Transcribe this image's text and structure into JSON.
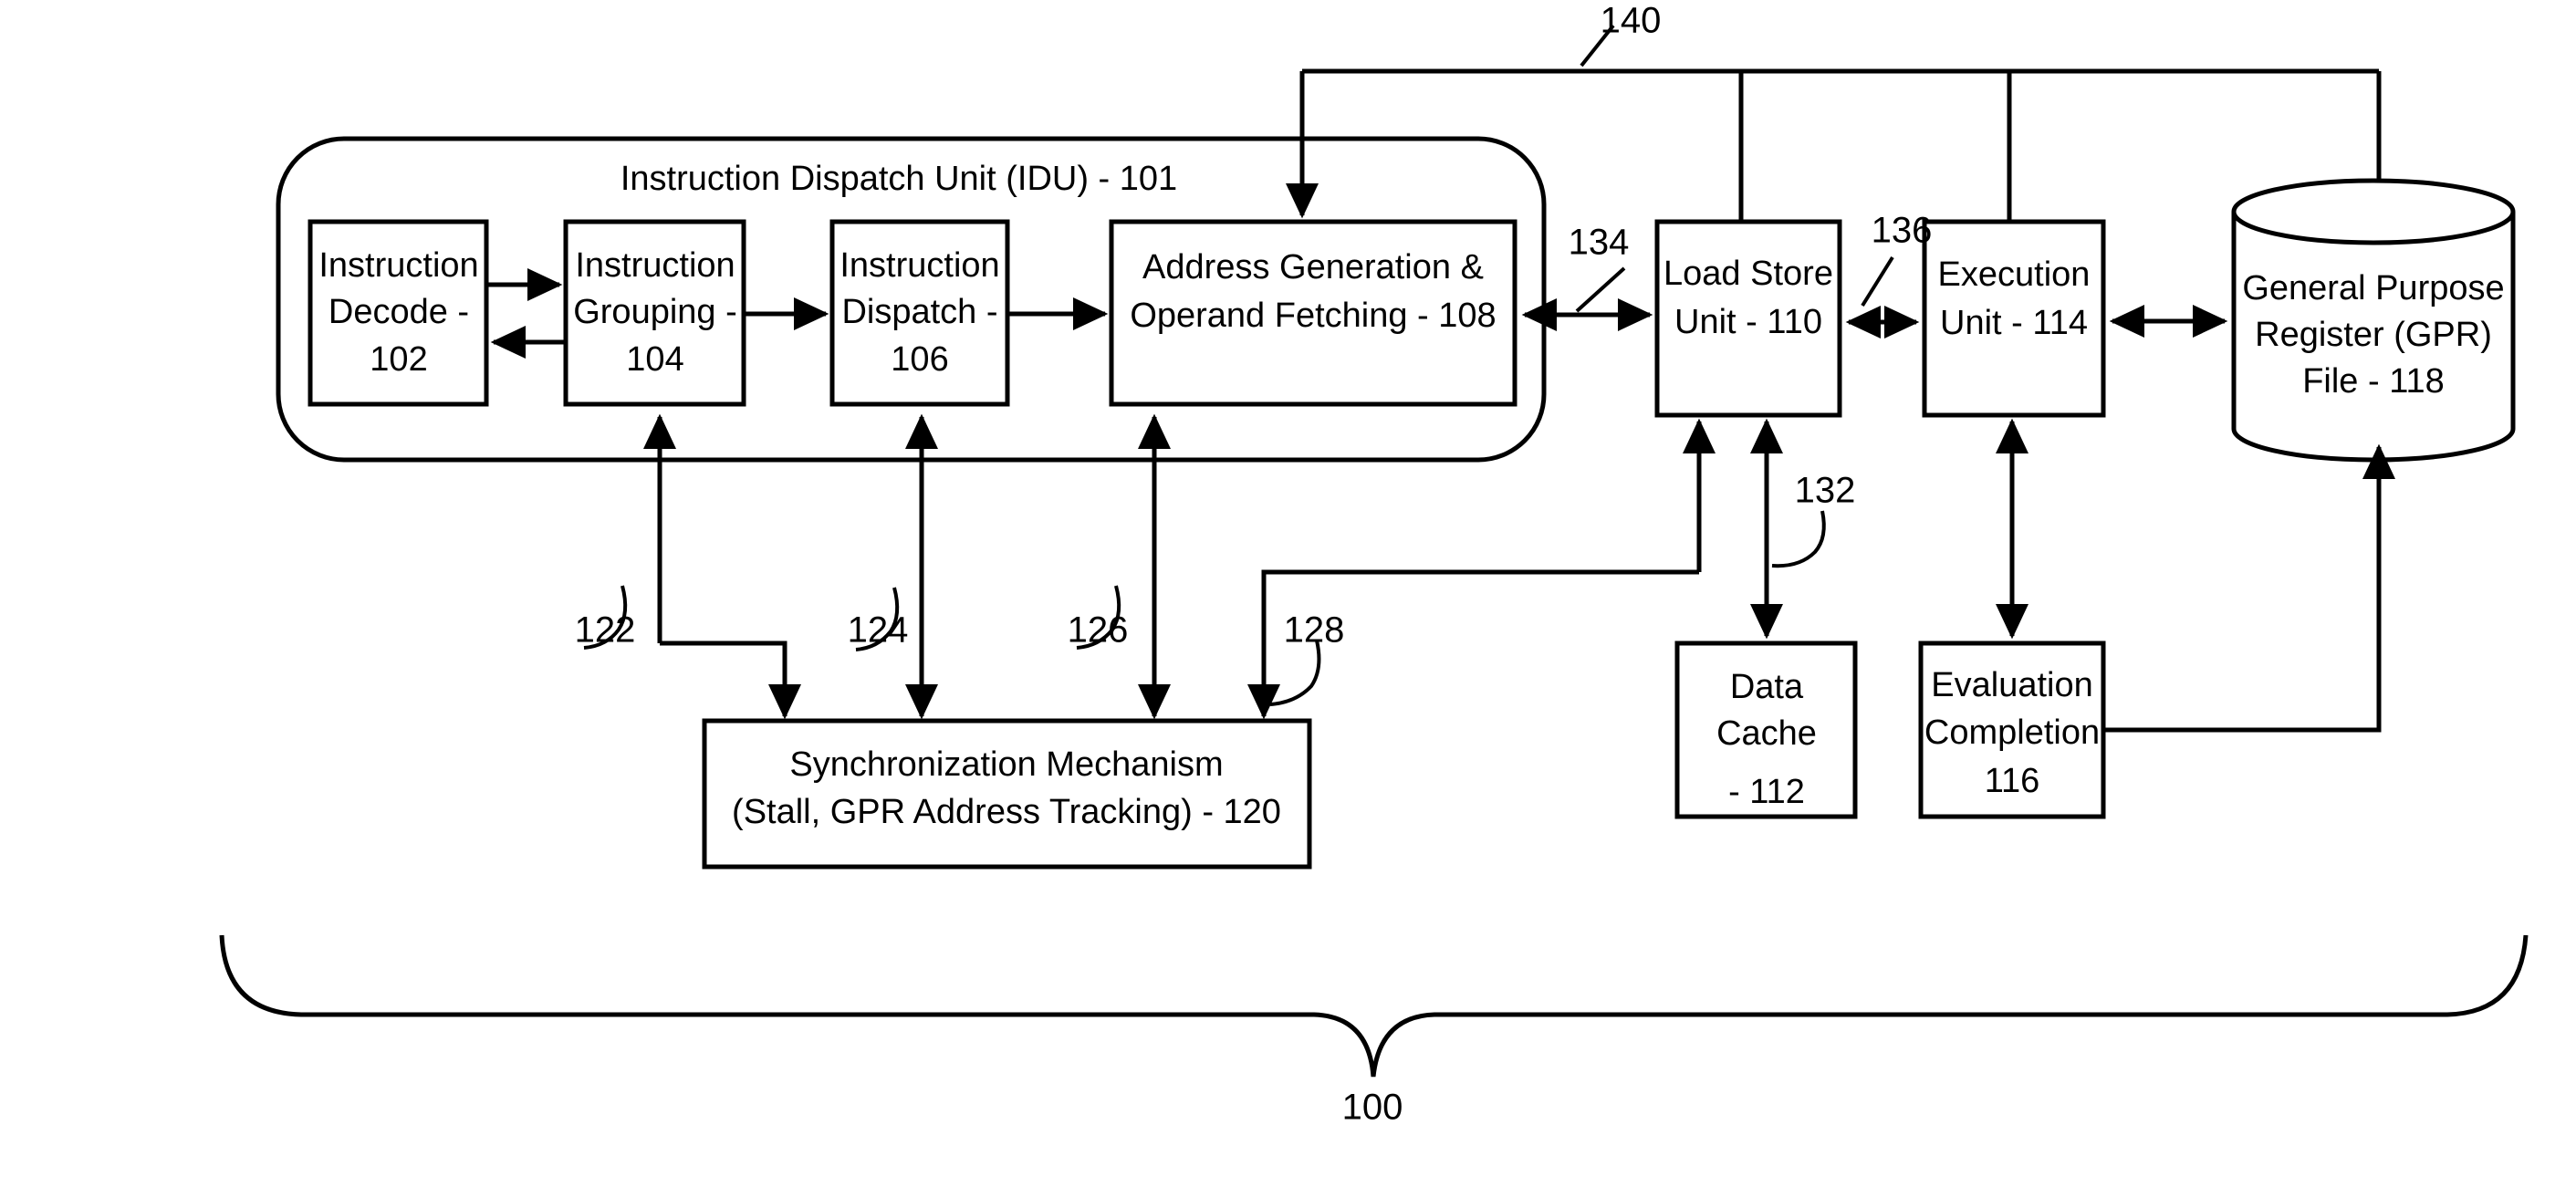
{
  "figure": {
    "overall_reference": "100",
    "bus_reference": "140",
    "idu_title": "Instruction Dispatch Unit (IDU) - 101"
  },
  "blocks": {
    "instruction_decode": {
      "line1": "Instruction",
      "line2": "Decode -",
      "line3": "102"
    },
    "instruction_grouping": {
      "line1": "Instruction",
      "line2": "Grouping -",
      "line3": "104"
    },
    "instruction_dispatch": {
      "line1": "Instruction",
      "line2": "Dispatch -",
      "line3": "106"
    },
    "address_generation": {
      "line1": "Address Generation &",
      "line2": "Operand Fetching - 108"
    },
    "load_store_unit": {
      "line1": "Load Store",
      "line2": "Unit - 110"
    },
    "execution_unit": {
      "line1": "Execution",
      "line2": "Unit - 114"
    },
    "gpr_file": {
      "line1": "General Purpose",
      "line2": "Register (GPR)",
      "line3": "File - 118"
    },
    "data_cache": {
      "line1": "Data",
      "line2": "Cache",
      "line3": "- 112"
    },
    "evaluation_completion": {
      "line1": "Evaluation",
      "line2": "Completion",
      "line3": "116"
    },
    "synchronization_mechanism": {
      "line1": "Synchronization Mechanism",
      "line2": "(Stall, GPR Address Tracking) - 120"
    }
  },
  "reference_numerals": {
    "n122": "122",
    "n124": "124",
    "n126": "126",
    "n128": "128",
    "n132": "132",
    "n134": "134",
    "n136": "136",
    "n140": "140",
    "n100": "100"
  },
  "colors": {
    "stroke": "#000000",
    "background": "#ffffff",
    "fill": "#ffffff"
  }
}
